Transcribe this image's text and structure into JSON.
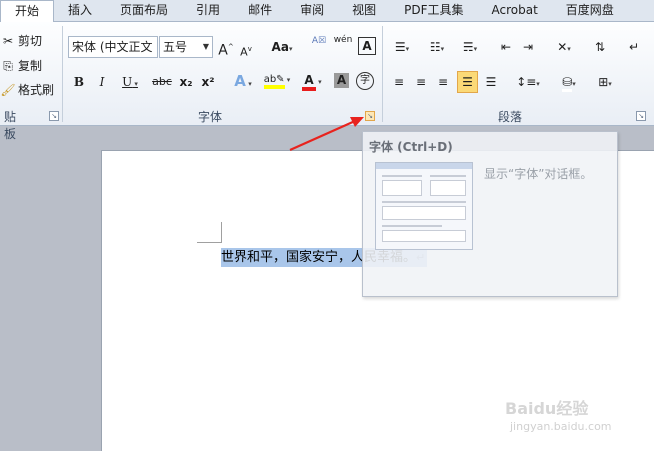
{
  "tabs": [
    {
      "label": "开始",
      "active": true
    },
    {
      "label": "插入"
    },
    {
      "label": "页面布局"
    },
    {
      "label": "引用"
    },
    {
      "label": "邮件"
    },
    {
      "label": "审阅"
    },
    {
      "label": "视图"
    },
    {
      "label": "PDF工具集"
    },
    {
      "label": "Acrobat"
    },
    {
      "label": "百度网盘"
    }
  ],
  "clipboard": {
    "cut": "剪切",
    "copy": "复制",
    "format_painter": "格式刷",
    "group_label": "贴板"
  },
  "font_group": {
    "font_name": "宋体 (中文正文",
    "font_size": "五号",
    "group_label": "字体",
    "buttons": {
      "grow": "A",
      "shrink": "A",
      "change_case": "Aa",
      "clear": "A",
      "bold": "B",
      "italic": "I",
      "underline": "U",
      "strike": "abc",
      "subscript": "x₂",
      "superscript": "x²",
      "effects": "A",
      "highlight": "ab",
      "font_color": "A",
      "char_shading": "A",
      "enclose": "字",
      "phonetic": "wén"
    }
  },
  "paragraph_group": {
    "group_label": "段落"
  },
  "document": {
    "text": "世界和平，国家安宁，人民幸福。",
    "para_mark": "↵"
  },
  "tooltip": {
    "title": "字体 (Ctrl+D)",
    "description": "显示“字体”对话框。"
  },
  "colors": {
    "highlight": "#ffff00",
    "font_color": "#e81c1c",
    "arrow": "#e8231e",
    "selection": "#a9c6ea"
  },
  "watermark": {
    "brand": "Baidu经验",
    "url": "jingyan.baidu.com"
  }
}
